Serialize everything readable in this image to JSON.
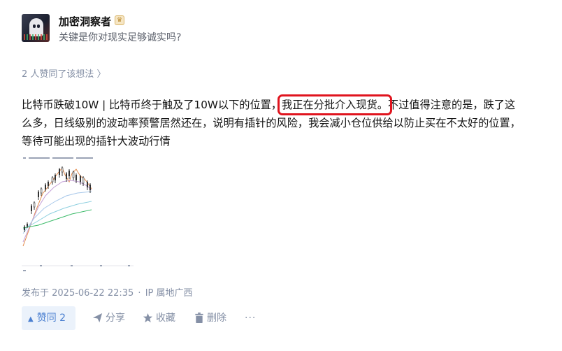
{
  "author": {
    "name": "加密洞察者",
    "headline": "关键是你对现实足够诚实吗?",
    "badge_icon": "level-badge-icon"
  },
  "likes_line": "2 人赞同了该想法 〉",
  "post": {
    "text_before": "比特币跌破10W | 比特币终于触及了10W以下的位置，",
    "text_highlight": "我正在分批介入现货。",
    "text_after": "不过值得注意的是，跌了这么多，日线级别的波动率预警居然还在，说明有插针的风险，我会减小仓位供给以防止买在不太好的位置，等待可能出现的插针大波动行情",
    "highlight_color": "#e0141e"
  },
  "meta": {
    "published": "发布于 2025-06-22 22:35",
    "separator": "·",
    "ip": "IP 属地广西"
  },
  "actions": {
    "like_label": "赞同 2",
    "share_label": "分享",
    "favorite_label": "收藏",
    "delete_label": "删除",
    "more_label": "···"
  },
  "colors": {
    "accent": "#4a7fd0",
    "muted": "#8590a6",
    "like_bg": "#ebf2fb"
  }
}
